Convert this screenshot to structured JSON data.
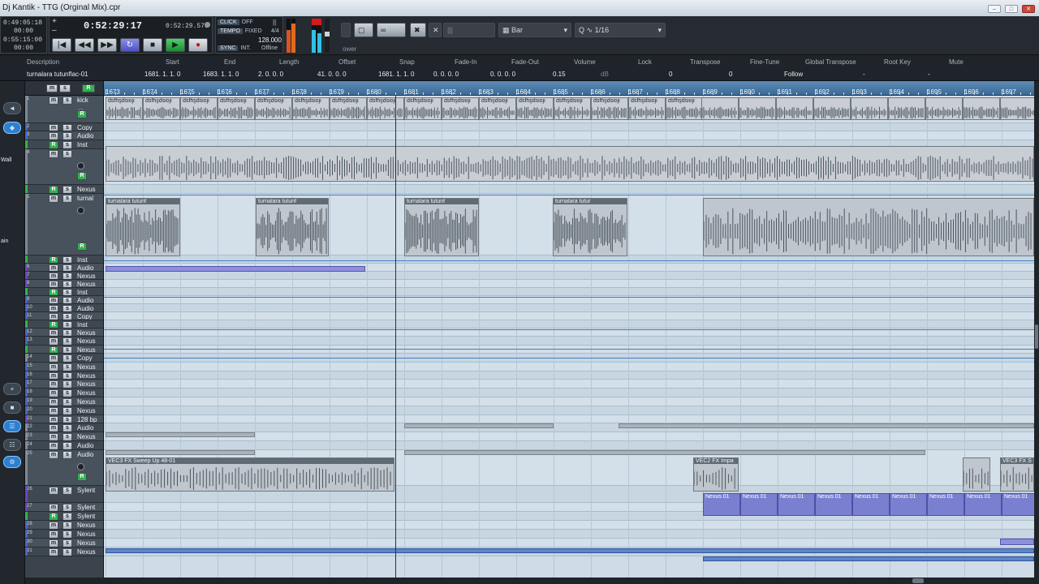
{
  "window": {
    "title": "Dj Kantik - TTG (Orginal Mix).cpr",
    "buttons": [
      "minimize",
      "maximize",
      "close"
    ]
  },
  "transport": {
    "left_times": [
      "0:49:05:18",
      "00:00",
      "0:55:15:00",
      "00:00"
    ],
    "position": "0:52:29:17",
    "secondary_position": "0:52:29.579",
    "click_label": "CLICK",
    "click_value": "OFF",
    "tempo_label": "TEMPO",
    "tempo_value": "FIXED",
    "signature": "4/4",
    "tempo": "128.000",
    "sync_label": "SYNC",
    "sync_value": "INT.",
    "offline": "Offline",
    "buttons": [
      "go-to-start",
      "rewind",
      "fast-forward",
      "cycle",
      "stop",
      "play",
      "record"
    ],
    "power_text": "ower"
  },
  "toolbar": {
    "snap_mode": "Bar",
    "quantize_label": "Q",
    "quantize_value": "1/16"
  },
  "infoline": {
    "columns": [
      {
        "header": "Description",
        "value": "turnalara tutunflac-01"
      },
      {
        "header": "Start",
        "value": "1681.  1.  1.    0"
      },
      {
        "header": "End",
        "value": "1683.  1.  1.    0"
      },
      {
        "header": "Length",
        "value": "2.  0.  0.    0"
      },
      {
        "header": "Offset",
        "value": "41.  0.  0.    0"
      },
      {
        "header": "Snap",
        "value": "1681.  1.  1.    0"
      },
      {
        "header": "Fade-In",
        "value": "0.  0.  0.    0"
      },
      {
        "header": "Fade-Out",
        "value": "0.  0.  0.    0"
      },
      {
        "header": "Volume",
        "value": "0.15"
      },
      {
        "header": "Lock",
        "value": ""
      },
      {
        "header": "Transpose",
        "value": "0"
      },
      {
        "header": "Fine-Tune",
        "value": "0"
      },
      {
        "header": "Global Transpose",
        "value": "Follow"
      },
      {
        "header": "Root Key",
        "value": "-"
      },
      {
        "header": "Mute",
        "value": "-"
      }
    ],
    "volume_unit": "dB"
  },
  "left_strip": {
    "labels": [
      "Wall",
      "ain"
    ]
  },
  "ruler": {
    "bars": [
      "1673",
      "1674",
      "1675",
      "1676",
      "1677",
      "1678",
      "1679",
      "1680",
      "1681",
      "1682",
      "1683",
      "1684",
      "1685",
      "1686",
      "1687",
      "1688",
      "1689",
      "1690",
      "1691",
      "1692",
      "1693",
      "1694",
      "1695",
      "1696",
      "1697"
    ]
  },
  "tracks": [
    {
      "num": "1",
      "name": "kick",
      "color": "#7d8a96",
      "rec": false
    },
    {
      "num": "2",
      "name": "Copy",
      "color": "#4b62c4",
      "rec": false
    },
    {
      "num": "3",
      "name": "Audio",
      "color": "#4b62c4",
      "rec": false
    },
    {
      "num": "",
      "name": "Inst",
      "color": "#33b24d",
      "rec": true
    },
    {
      "num": "4",
      "name": "",
      "color": "#7d8a96",
      "rec": false
    },
    {
      "num": "",
      "name": "Nexus",
      "color": "#33b24d",
      "rec": true
    },
    {
      "num": "5",
      "name": "turnal",
      "color": "#7d8a96",
      "rec": false
    },
    {
      "num": "",
      "name": "Inst",
      "color": "#33b24d",
      "rec": true
    },
    {
      "num": "6",
      "name": "Audio",
      "color": "#6a45c0",
      "rec": false
    },
    {
      "num": "7",
      "name": "Nexus",
      "color": "#6a45c0",
      "rec": false
    },
    {
      "num": "8",
      "name": "Nexus",
      "color": "#6a45c0",
      "rec": false
    },
    {
      "num": "",
      "name": "Inst",
      "color": "#33b24d",
      "rec": true
    },
    {
      "num": "9",
      "name": "Audio",
      "color": "#4b62c4",
      "rec": false
    },
    {
      "num": "10",
      "name": "Audio",
      "color": "#4b62c4",
      "rec": false
    },
    {
      "num": "11",
      "name": "Copy",
      "color": "#4b62c4",
      "rec": false
    },
    {
      "num": "",
      "name": "Inst",
      "color": "#33b24d",
      "rec": true
    },
    {
      "num": "12",
      "name": "Nexus",
      "color": "#4b62c4",
      "rec": false
    },
    {
      "num": "13",
      "name": "Nexus",
      "color": "#4b62c4",
      "rec": false
    },
    {
      "num": "",
      "name": "Nexus",
      "color": "#33b24d",
      "rec": true
    },
    {
      "num": "14",
      "name": "Copy",
      "color": "#7d8a96",
      "rec": false
    },
    {
      "num": "15",
      "name": "Nexus",
      "color": "#4b62c4",
      "rec": false
    },
    {
      "num": "16",
      "name": "Nexus",
      "color": "#4b62c4",
      "rec": false
    },
    {
      "num": "17",
      "name": "Nexus",
      "color": "#4b62c4",
      "rec": false
    },
    {
      "num": "18",
      "name": "Nexus",
      "color": "#4b62c4",
      "rec": false
    },
    {
      "num": "19",
      "name": "Nexus",
      "color": "#4b62c4",
      "rec": false
    },
    {
      "num": "20",
      "name": "Nexus",
      "color": "#4b62c4",
      "rec": false
    },
    {
      "num": "21",
      "name": "128 bp",
      "color": "#6a45c0",
      "rec": false
    },
    {
      "num": "22",
      "name": "Audio",
      "color": "#7d8a96",
      "rec": false
    },
    {
      "num": "23",
      "name": "Nexus",
      "color": "#7d8a96",
      "rec": false
    },
    {
      "num": "24",
      "name": "Audio",
      "color": "#7d8a96",
      "rec": false
    },
    {
      "num": "25",
      "name": "Audio",
      "color": "#7d8a96",
      "rec": false
    },
    {
      "num": "26",
      "name": "Sylent",
      "color": "#6a45c0",
      "rec": false
    },
    {
      "num": "27",
      "name": "Sylent",
      "color": "#6a45c0",
      "rec": false
    },
    {
      "num": "",
      "name": "Sylent",
      "color": "#33b24d",
      "rec": true
    },
    {
      "num": "28",
      "name": "Nexus",
      "color": "#4b62c4",
      "rec": false
    },
    {
      "num": "29",
      "name": "Nexus",
      "color": "#4b62c4",
      "rec": false
    },
    {
      "num": "30",
      "name": "Nexus",
      "color": "#4b62c4",
      "rec": false
    },
    {
      "num": "31",
      "name": "Nexus",
      "color": "#4b62c4",
      "rec": false
    }
  ],
  "events": {
    "kick_part": "dsfhşdsioji",
    "audio_clip": "turnalara tutunf",
    "audio_clip_selected": "turnalara tutunf",
    "audio_clip_short": "turnalara tutur",
    "sweep": "VEC3 FX Sweep Up 48-01",
    "impact": "VEC2 FX Impa",
    "vec3_short": "VEC3 FX S",
    "nexus_part": "Nexus 01"
  },
  "colors": {
    "ruler": "#4f7eab",
    "arrange_bg": "#cfdbe6",
    "midi_part": "#7b7fd0",
    "automation": "#3f7fc6",
    "play": "#1b8c33",
    "record": "#d0141a"
  }
}
